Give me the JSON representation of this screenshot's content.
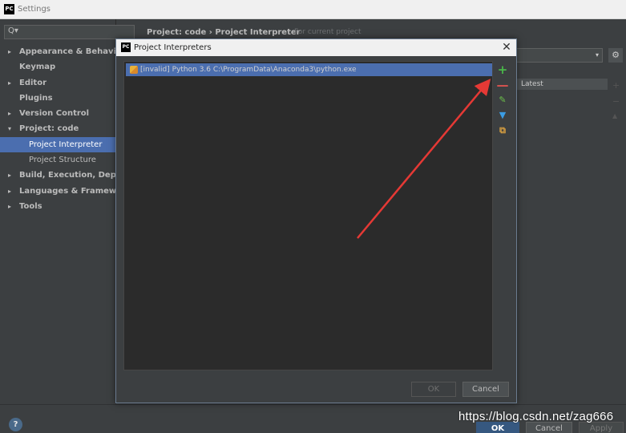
{
  "settings_window": {
    "title": "Settings",
    "app_icon_text": "PC",
    "search_icon_text": "Q▾",
    "breadcrumb": "Project: code  ›  Project Interpreter",
    "breadcrumb_hint": "For current project",
    "latest_column": "Latest",
    "sidebar": {
      "items": [
        {
          "label": "Appearance & Behavior",
          "arrow": "▸"
        },
        {
          "label": "Keymap",
          "arrow": ""
        },
        {
          "label": "Editor",
          "arrow": "▸"
        },
        {
          "label": "Plugins",
          "arrow": ""
        },
        {
          "label": "Version Control",
          "arrow": "▸"
        },
        {
          "label": "Project: code",
          "arrow": "▾"
        },
        {
          "label": "Project Interpreter",
          "arrow": ""
        },
        {
          "label": "Project Structure",
          "arrow": ""
        },
        {
          "label": "Build, Execution, Deployment",
          "arrow": "▸"
        },
        {
          "label": "Languages & Frameworks",
          "arrow": "▸"
        },
        {
          "label": "Tools",
          "arrow": "▸"
        }
      ]
    },
    "help_label": "?",
    "ok_label": "OK",
    "cancel_label": "Cancel",
    "apply_label": "Apply"
  },
  "dialog": {
    "title": "Project Interpreters",
    "app_icon_text": "PC",
    "close_glyph": "✕",
    "interpreters": [
      {
        "text": "[invalid] Python 3.6 C:\\ProgramData\\Anaconda3\\python.exe",
        "icon": "python-icon"
      }
    ],
    "toolbar": {
      "add": "+",
      "remove": "—",
      "edit": "✎",
      "filter": "▼",
      "paths": "⧉"
    },
    "ok_label": "OK",
    "cancel_label": "Cancel"
  },
  "watermark": "https://blog.csdn.net/zag666",
  "colors": {
    "annotation_arrow": "#e53935",
    "selection": "#4b6eaf",
    "background": "#3c3f41"
  }
}
